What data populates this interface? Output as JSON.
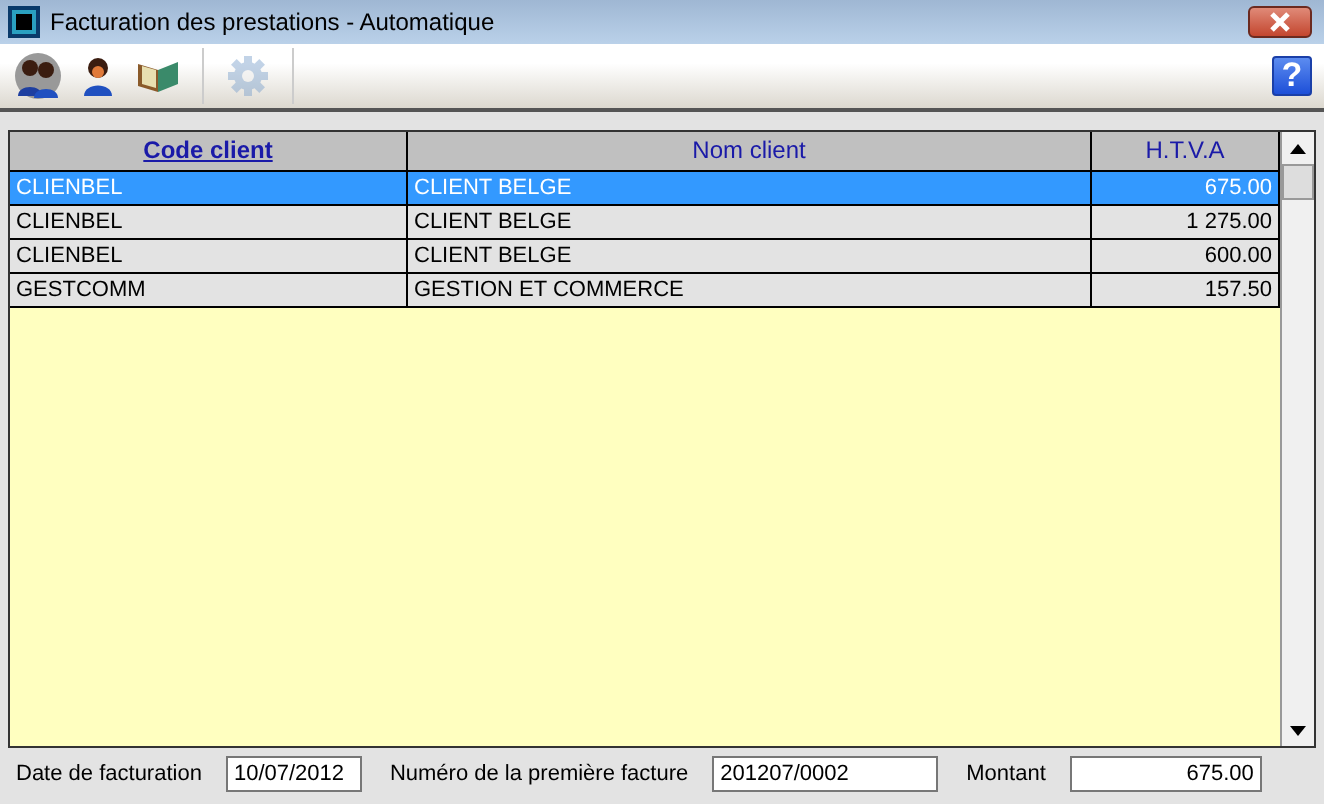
{
  "window": {
    "title": "Facturation des prestations - Automatique"
  },
  "toolbar": {
    "tools": [
      {
        "kind": "people",
        "disabled": false
      },
      {
        "kind": "person",
        "disabled": false
      },
      {
        "kind": "book",
        "disabled": false
      },
      {
        "kind": "gear",
        "disabled": true
      }
    ],
    "help": "?"
  },
  "table": {
    "columns": [
      {
        "label": "Code client",
        "sorted": true
      },
      {
        "label": "Nom client",
        "sorted": false
      },
      {
        "label": "H.T.V.A",
        "sorted": false
      }
    ],
    "rows": [
      {
        "cells": [
          "CLIENBEL",
          "CLIENT BELGE",
          "675.00"
        ],
        "selected": true
      },
      {
        "cells": [
          "CLIENBEL",
          "CLIENT BELGE",
          "1 275.00"
        ],
        "selected": false
      },
      {
        "cells": [
          "CLIENBEL",
          "CLIENT BELGE",
          "600.00"
        ],
        "selected": false
      },
      {
        "cells": [
          "GESTCOMM",
          "GESTION ET COMMERCE",
          "157.50"
        ],
        "selected": false
      }
    ]
  },
  "footer": [
    {
      "label": "Date de facturation",
      "value": "10/07/2012"
    },
    {
      "label": "Numéro de la première facture",
      "value": "201207/0002"
    },
    {
      "label": "Montant",
      "value": "675.00"
    }
  ]
}
